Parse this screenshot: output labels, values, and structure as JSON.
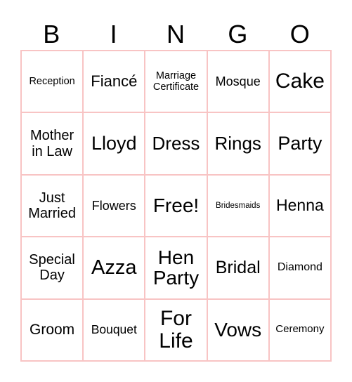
{
  "header": {
    "letters": [
      "B",
      "I",
      "N",
      "G",
      "O"
    ]
  },
  "theme": {
    "grid_line_color": "#f8c4c4",
    "text_color": "#000000",
    "background": "#ffffff"
  },
  "board": {
    "rows": [
      [
        "Reception",
        "Fiancé",
        "Marriage Certificate",
        "Mosque",
        "Cake"
      ],
      [
        "Mother in Law",
        "Lloyd",
        "Dress",
        "Rings",
        "Party"
      ],
      [
        "Just Married",
        "Flowers",
        "Free!",
        "Bridesmaids",
        "Henna"
      ],
      [
        "Special Day",
        "Azza",
        "Hen Party",
        "Bridal",
        "Diamond"
      ],
      [
        "Groom",
        "Bouquet",
        "For Life",
        "Vows",
        "Ceremony"
      ]
    ],
    "free_space": "Free!"
  }
}
